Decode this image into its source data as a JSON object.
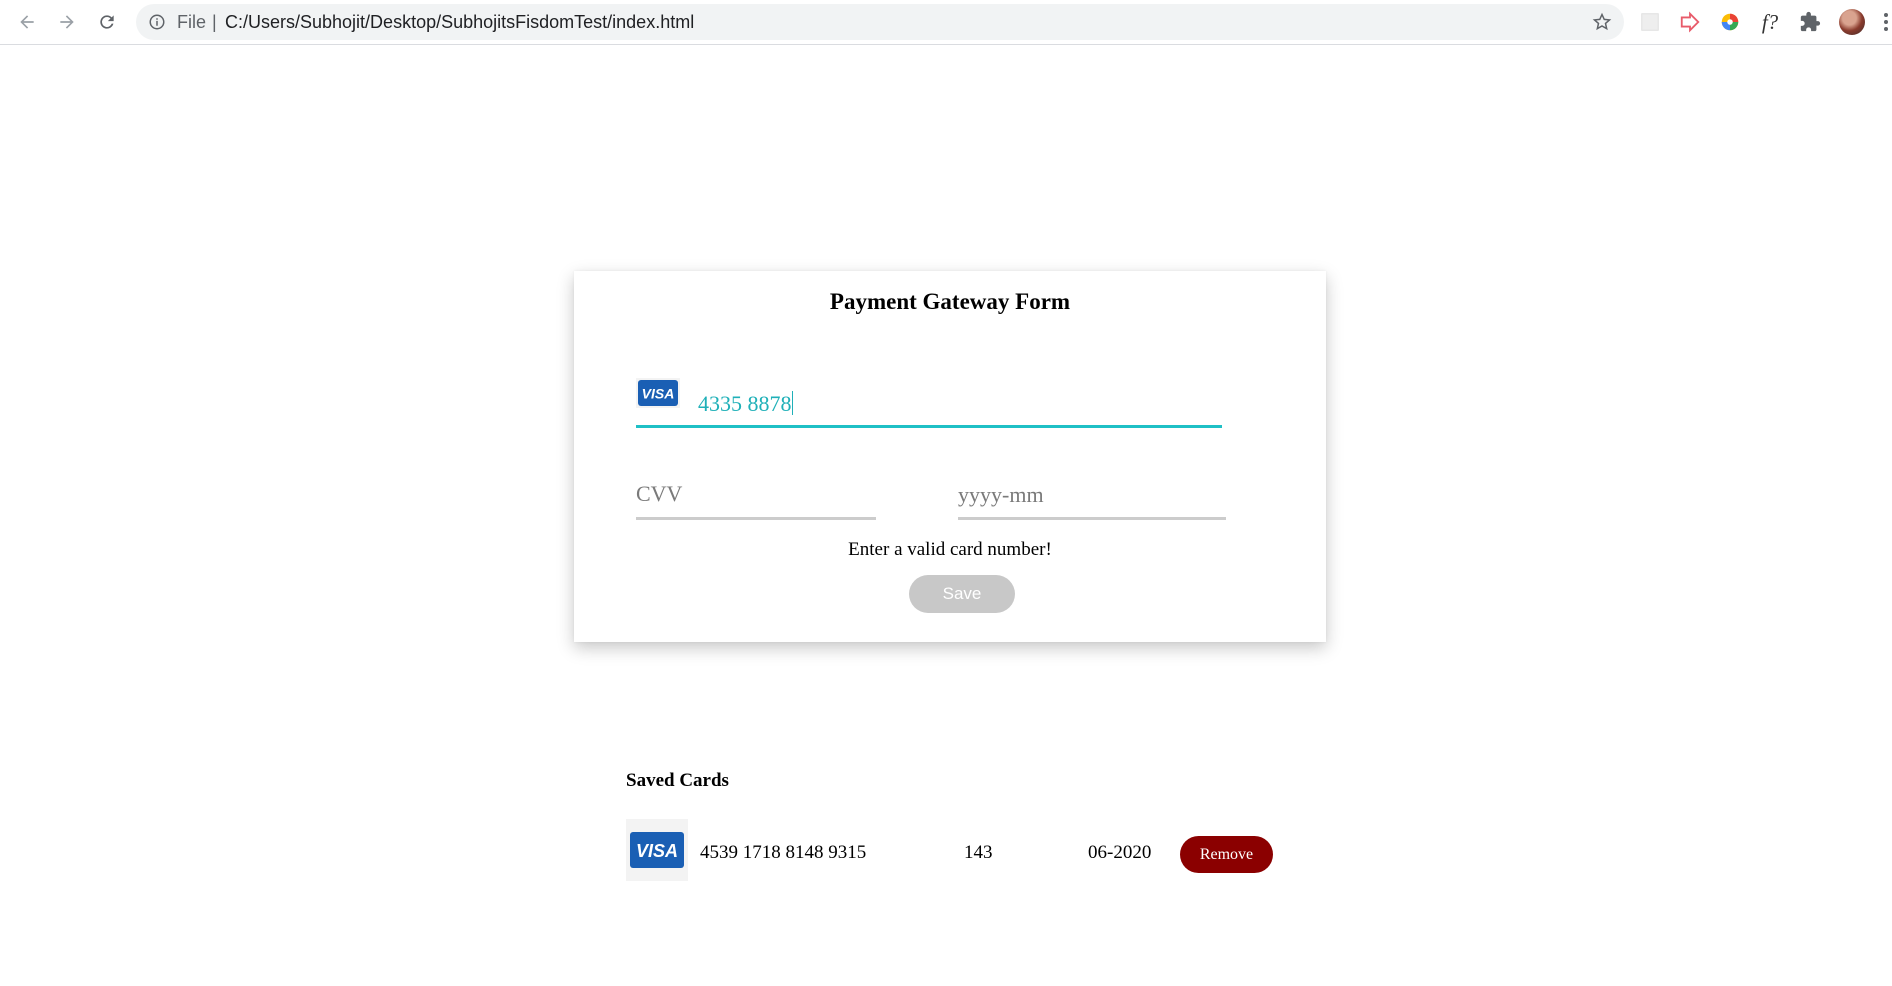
{
  "browser": {
    "scheme_label": "File",
    "separator": "|",
    "url": "C:/Users/Subhojit/Desktop/SubhojitsFisdomTest/index.html",
    "extension_fx_label": "f?"
  },
  "form": {
    "title": "Payment Gateway Form",
    "card_brand": "VISA",
    "card_number_value": "4335 8878",
    "cvv_placeholder": "CVV",
    "expiry_placeholder": "yyyy-mm",
    "error_message": "Enter a valid card number!",
    "save_label": "Save"
  },
  "saved_cards": {
    "title": "Saved Cards",
    "items": [
      {
        "brand": "VISA",
        "number": "4539 1718 8148 9315",
        "cvv": "143",
        "expiry": "06-2020",
        "remove_label": "Remove"
      }
    ]
  },
  "colors": {
    "accent_active": "#1fc0c6",
    "save_disabled": "#c8c8c8",
    "remove_button": "#8b0000",
    "visa_blue": "#1a5fb4"
  }
}
